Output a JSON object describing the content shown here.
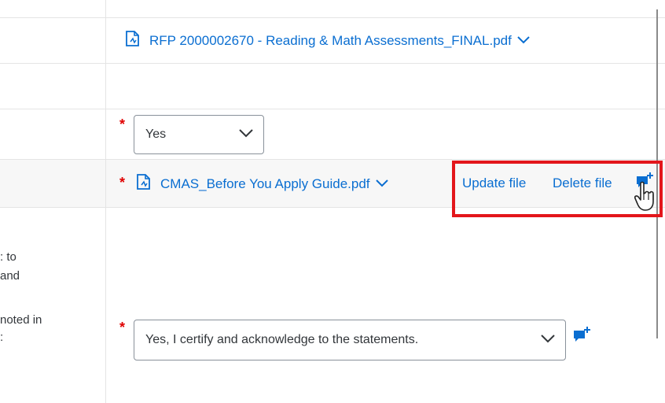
{
  "attachments": {
    "rfp_file": {
      "name": "RFP 2000002670 - Reading & Math Assessments_FINAL.pdf"
    },
    "cmas_file": {
      "name": "CMAS_Before You Apply Guide.pdf"
    }
  },
  "questions": {
    "q1": {
      "required_mark": "*",
      "selected": "Yes"
    },
    "q2": {
      "required_mark": "*",
      "update_label": "Update file",
      "delete_label": "Delete file"
    },
    "q3": {
      "required_mark": "*",
      "selected": "Yes, I certify and acknowledge to the statements.",
      "text_line1": ": to",
      "text_line2": "and",
      "text_line3": " noted in",
      "text_line4": ":"
    }
  },
  "colors": {
    "link": "#0a6ed1",
    "required": "#e00000",
    "highlight": "#e3161b"
  },
  "icons": {
    "file": "pdf-document-icon",
    "chevron": "chevron-down-icon",
    "comment": "add-comment-icon",
    "cursor": "hand-pointer-icon"
  }
}
